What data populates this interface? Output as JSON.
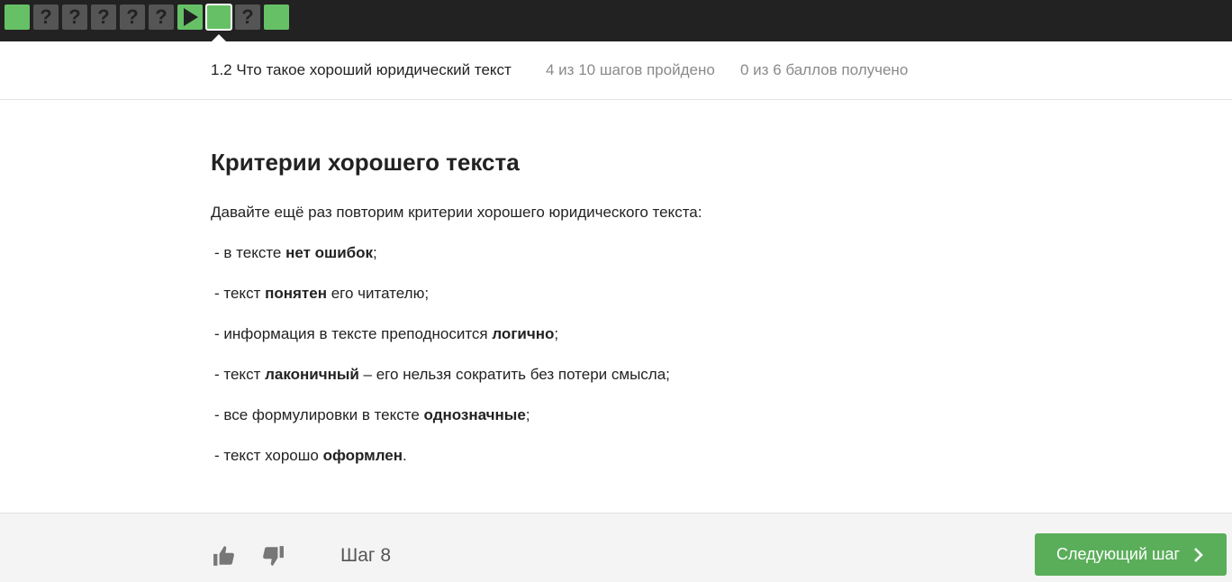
{
  "stepbar": {
    "steps": [
      {
        "state": "done",
        "icon": "check-square",
        "label": ""
      },
      {
        "state": "unknown",
        "icon": "question-icon",
        "label": "?"
      },
      {
        "state": "unknown",
        "icon": "question-icon",
        "label": "?"
      },
      {
        "state": "unknown",
        "icon": "question-icon",
        "label": "?"
      },
      {
        "state": "unknown",
        "icon": "question-icon",
        "label": "?"
      },
      {
        "state": "unknown",
        "icon": "question-icon",
        "label": "?"
      },
      {
        "state": "video",
        "icon": "play-icon",
        "label": ""
      },
      {
        "state": "current",
        "icon": "",
        "label": ""
      },
      {
        "state": "unknown",
        "icon": "question-icon",
        "label": "?"
      },
      {
        "state": "done",
        "icon": "",
        "label": ""
      }
    ],
    "colors": {
      "bar": "#222222",
      "done": "#66c166",
      "unknown": "#555555"
    }
  },
  "header": {
    "lesson_title": "1.2 Что такое хороший юридический текст",
    "progress": "4 из 10 шагов пройдено",
    "score": "0 из 6 баллов  получено"
  },
  "content": {
    "heading": "Критерии хорошего текста",
    "intro": "Давайте ещё раз повторим критерии хорошего юридического текста:",
    "items": [
      {
        "pre": "- в тексте ",
        "bold": "нет ошибок",
        "post": ";"
      },
      {
        "pre": "- текст ",
        "bold": "понятен",
        "post": " его читателю;"
      },
      {
        "pre": "- информация в тексте преподносится ",
        "bold": "логично",
        "post": ";"
      },
      {
        "pre": "- текст ",
        "bold": "лаконичный",
        "post": " – его нельзя сократить без потери смысла;"
      },
      {
        "pre": "- все формулировки в тексте ",
        "bold": "однозначные",
        "post": ";"
      },
      {
        "pre": "- текст хорошо ",
        "bold": "оформлен",
        "post": "."
      }
    ]
  },
  "footer": {
    "step_label": "Шаг 8",
    "next_button": "Следующий шаг",
    "like_icon": "thumbs-up-icon",
    "dislike_icon": "thumbs-down-icon",
    "accent": "#5aae5a"
  }
}
